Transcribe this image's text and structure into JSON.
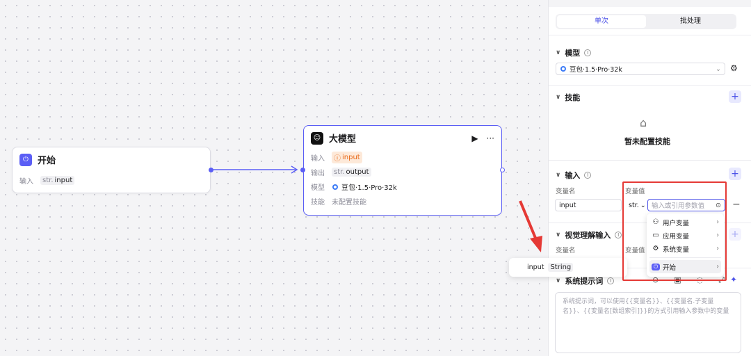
{
  "canvas": {
    "start_node": {
      "title": "开始",
      "input_label": "输入",
      "input_type": "str.",
      "input_name": "input"
    },
    "llm_node": {
      "title": "大模型",
      "input_label": "输入",
      "input_value": "input",
      "output_label": "输出",
      "output_type": "str.",
      "output_name": "output",
      "model_label": "模型",
      "model_value": "豆包·1.5·Pro·32k",
      "skill_label": "技能",
      "skill_value": "未配置技能"
    }
  },
  "panel": {
    "tabs": [
      "单次",
      "批处理"
    ],
    "model_section": {
      "title": "模型",
      "selected_model": "豆包·1.5·Pro·32k"
    },
    "skills_section": {
      "title": "技能",
      "empty_text": "暂未配置技能"
    },
    "input_section": {
      "title": "输入",
      "col_name": "变量名",
      "col_value": "变量值",
      "row": {
        "name": "input",
        "type": "str.",
        "value_placeholder": "输入或引用参数值"
      }
    },
    "vision_section": {
      "title": "视觉理解输入",
      "col_name": "变量名",
      "col_value": "变量值"
    },
    "system_prompt_section": {
      "title": "系统提示词",
      "placeholder": "系统提示词，可以使用{{变量名}}、{{变量名.子变量名}}、{{变量名[数组索引]}}的方式引用输入参数中的变量"
    }
  },
  "variable_dropdown": {
    "items": [
      {
        "label": "用户变量",
        "icon": "user-icon"
      },
      {
        "label": "应用变量",
        "icon": "folder-icon"
      },
      {
        "label": "系统变量",
        "icon": "gear-icon"
      },
      {
        "label": "开始",
        "icon": "start-node-icon"
      }
    ]
  },
  "reference_popup": {
    "name": "input",
    "type": "String"
  },
  "colors": {
    "accent": "#4d53e8",
    "highlight_box": "#e53935"
  }
}
